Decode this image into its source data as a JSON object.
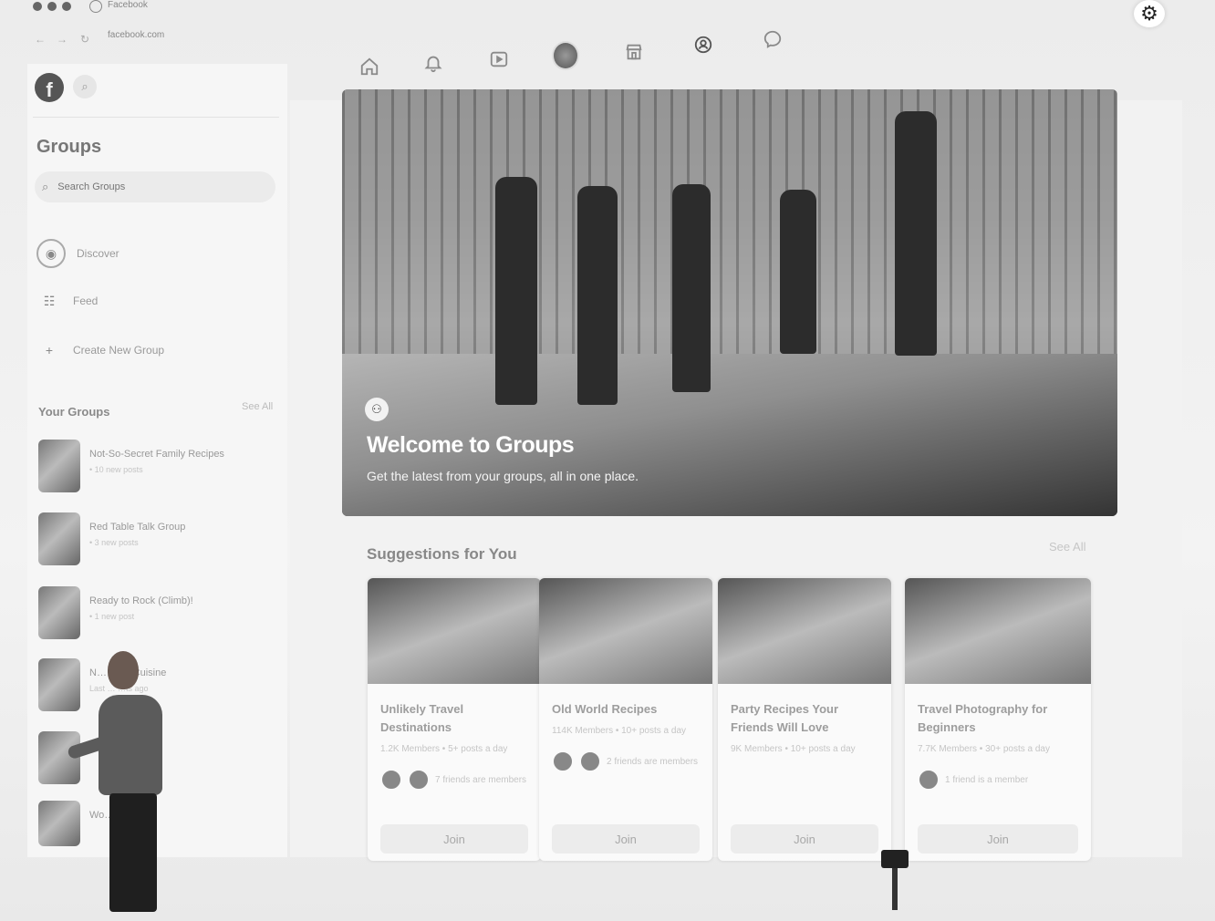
{
  "browser": {
    "tab_label": "Facebook",
    "url": "facebook.com",
    "nav_back": "←",
    "nav_forward": "→",
    "nav_reload": "↻"
  },
  "top_nav": {
    "icons": [
      "home-icon",
      "bell-icon",
      "video-icon",
      "profile-avatar",
      "marketplace-icon",
      "groups-icon",
      "messenger-icon"
    ]
  },
  "sidebar": {
    "title": "Groups",
    "search_placeholder": "Search Groups",
    "items": [
      {
        "label": "Discover",
        "icon": "compass-icon"
      },
      {
        "label": "Feed",
        "icon": "feed-icon"
      },
      {
        "label": "Create New Group",
        "icon": "plus-icon"
      }
    ],
    "your_groups_label": "Your Groups",
    "see_all": "See All",
    "groups": [
      {
        "name": "Not-So-Secret Family Recipes",
        "sub": "• 10 new posts"
      },
      {
        "name": "Red Table Talk Group",
        "sub": "• 3 new posts"
      },
      {
        "name": "Ready to Rock (Climb)!",
        "sub": "• 1 new post"
      },
      {
        "name": "N… …ch Cuisine",
        "sub": "Last … …ts ago"
      },
      {
        "name": "",
        "sub": ""
      },
      {
        "name": "Wo…es",
        "sub": ""
      }
    ]
  },
  "hero": {
    "title": "Welcome to Groups",
    "subtitle": "Get the latest from your groups, all in one place."
  },
  "suggestions": {
    "title": "Suggestions for You",
    "see_all": "See All",
    "cards": [
      {
        "title": "Unlikely Travel Destinations",
        "info": "1.2K Members • 5+ posts a day",
        "friends": "7 friends are members",
        "join": "Join"
      },
      {
        "title": "Old World Recipes",
        "info": "114K Members • 10+ posts a day",
        "friends": "2 friends are members",
        "join": "Join"
      },
      {
        "title": "Party Recipes Your Friends Will Love",
        "info": "9K Members • 10+ posts a day",
        "friends": "",
        "join": "Join"
      },
      {
        "title": "Travel Photography for Beginners",
        "info": "7.7K Members • 30+ posts a day",
        "friends": "1 friend is a member",
        "join": "Join"
      }
    ]
  },
  "colors": {
    "page_bg": "#e7e7e7",
    "sidebar_bg": "#f6f6f6",
    "hero_text": "#ffffff",
    "muted_text": "#9a9a9a"
  }
}
